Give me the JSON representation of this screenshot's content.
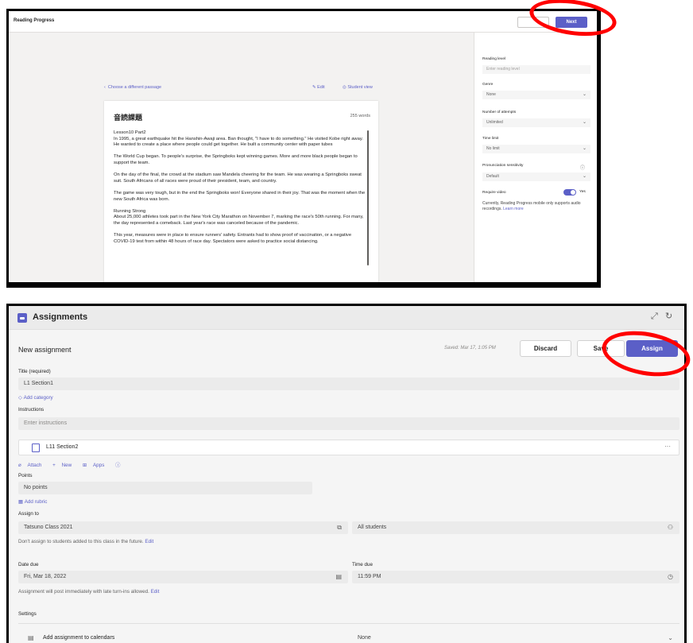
{
  "top": {
    "app_title": "Reading Progress",
    "next_label": "Next",
    "back_link": "Choose a different passage",
    "edit_link": "Edit",
    "student_view_link": "Student view",
    "passage_title": "音読課題",
    "word_count": "255 words",
    "paragraphs": [
      "Lesson10 Part2\nIn 1995, a great earthquake hit the Hanshin-Awaji area.  Ban thought, \"I have to do something.\"  He visited Kobe right away.  He wanted to create a place where people could get together.  He built a community center with paper tubes",
      "The World Cup began. To people's surprise, the Springboks kept winning games. More and more black people began to support the team.",
      "On the day of the final, the crowd at the stadium saw Mandela cheering for the team. He was wearing a Springboks sweat suit. South Africans of all races were proud of their president, team, and country.",
      "The game was very tough, but in the end the Springboks won! Everyone shared in their joy. That was the moment when the new South Africa was born.",
      "Running Strong\nAbout 25,000 athletes took part in the New York City Marathon on November 7, marking the race's 50th running. For many, the day represented a comeback. Last year's race was canceled because of the pandemic.",
      "This year, measures were in place to ensure runners' safety. Entrants had to show proof of vaccination, or a negative COVID-19 test from within 48 hours of race day. Spectators were asked to practice social distancing."
    ],
    "settings": {
      "reading_level_label": "Reading level",
      "reading_level_placeholder": "Enter reading level",
      "genre_label": "Genre",
      "genre_value": "None",
      "attempts_label": "Number of attempts",
      "attempts_value": "Unlimited",
      "time_limit_label": "Time limit",
      "time_limit_value": "No limit",
      "pronunciation_label": "Pronunciation sensitivity",
      "pronunciation_value": "Default",
      "require_video_label": "Require video",
      "require_video_state": "Yes",
      "note_text": "Currently, Reading Progress mobile only supports audio recordings.",
      "learn_more": "Learn more"
    }
  },
  "bottom": {
    "app_title": "Assignments",
    "page_title": "New assignment",
    "saved_text": "Saved: Mar 17, 1:05 PM",
    "discard_label": "Discard",
    "save_label": "Save",
    "assign_label": "Assign",
    "title_label": "Title (required)",
    "title_value": "L1 Section1",
    "add_category": "Add category",
    "instructions_label": "Instructions",
    "instructions_placeholder": "Enter instructions",
    "attachment_name": "L11 Section2",
    "attach_label": "Attach",
    "new_label": "New",
    "apps_label": "Apps",
    "points_label": "Points",
    "points_value": "No points",
    "add_rubric": "Add rubric",
    "assign_to_label": "Assign to",
    "class_value": "Tatsuno Class 2021",
    "students_value": "All students",
    "assign_hint": "Don't assign to students added to this class in the future.",
    "edit_label": "Edit",
    "date_due_label": "Date due",
    "date_due_value": "Fri, Mar 18, 2022",
    "time_due_label": "Time due",
    "time_due_value": "11:59 PM",
    "post_hint": "Assignment will post immediately with late turn-ins allowed.",
    "settings_label": "Settings",
    "calendar_label": "Add assignment to calendars",
    "calendar_value": "None"
  },
  "colors": {
    "accent": "#5b5fc7",
    "highlight": "#ff0000"
  }
}
